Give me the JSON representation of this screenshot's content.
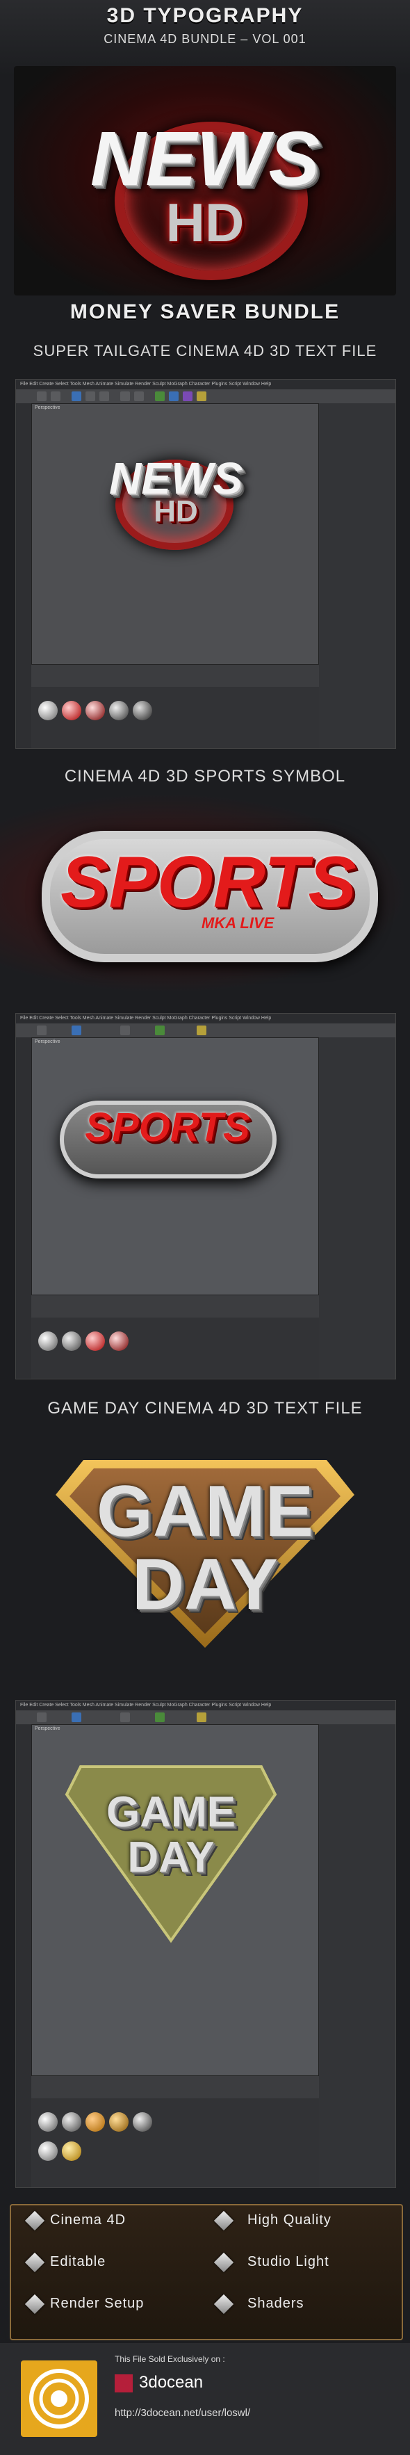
{
  "header": {
    "title": "3D TYPOGRAPHY",
    "subtitle": "CINEMA 4D BUNDLE – VOL 001"
  },
  "news_art": {
    "word": "NEWS",
    "badge": "HD"
  },
  "section_money": {
    "title": "MONEY SAVER BUNDLE",
    "subtitle": "SUPER TAILGATE CINEMA 4D 3D TEXT FILE"
  },
  "c4d_menu": "File  Edit  Create  Select  Tools  Mesh  Animate  Simulate  Render  Sculpt  MoGraph  Character  Plugins  Script  Window  Help",
  "c4d_viewport_label": "Perspective",
  "section_sports": {
    "title": "CINEMA 4D 3D SPORTS SYMBOL",
    "word": "SPORTS",
    "tag": "MKA LIVE"
  },
  "section_gameday": {
    "title": "GAME DAY CINEMA 4D 3D TEXT FILE",
    "line1": "GAME",
    "line2": "DAY"
  },
  "features": [
    {
      "label": "Cinema 4D"
    },
    {
      "label": "High Quality"
    },
    {
      "label": "Editable"
    },
    {
      "label": "Studio Light"
    },
    {
      "label": "Render Setup"
    },
    {
      "label": "Shaders"
    }
  ],
  "footer": {
    "sold_text": "This File Sold Exclusively on :",
    "brand": "3docean",
    "url": "http://3docean.net/user/loswl/"
  },
  "colors": {
    "accent_gold": "#e6a71d",
    "accent_red": "#e31b1b",
    "background": "#1c1d20"
  }
}
